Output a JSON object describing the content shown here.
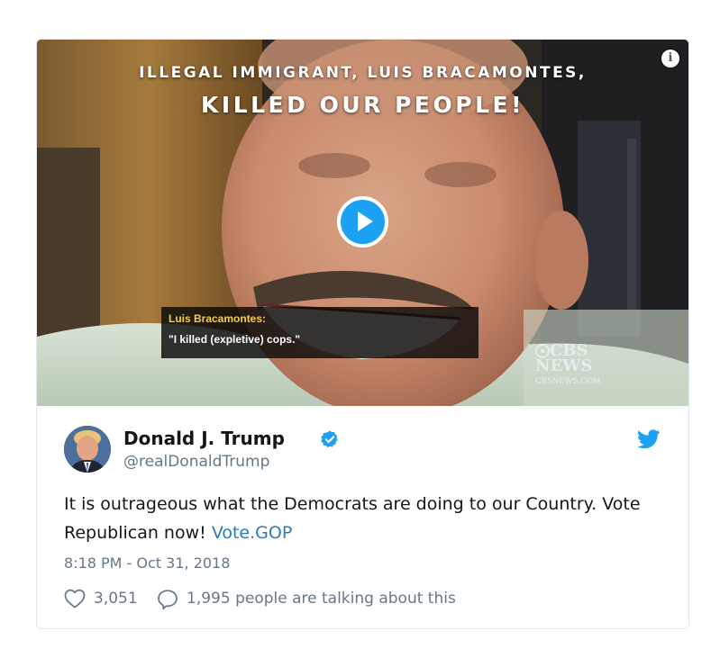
{
  "media": {
    "headline_line1": "ILLEGAL IMMIGRANT, LUIS BRACAMONTES,",
    "headline_line2": "KILLED OUR PEOPLE!",
    "caption_speaker": "Luis Bracamontes:",
    "caption_quote": "\"I killed (expletive) cops.\"",
    "network_logo_line1": "CBS",
    "network_logo_line2": "NEWS",
    "network_site": "CBSNEWS.COM",
    "info_icon": "info-icon",
    "play_icon": "play-icon"
  },
  "tweet": {
    "display_name": "Donald J. Trump",
    "handle": "@realDonaldTrump",
    "verified": true,
    "text_main": "It is outrageous what the Democrats are doing to our Country. Vote Republican now!",
    "text_link": "Vote.GOP",
    "timestamp": "8:18 PM - Oct 31, 2018",
    "likes": "3,051",
    "replies_text": "1,995 people are talking about this"
  },
  "colors": {
    "accent": "#1da1f2",
    "link": "#2b7bb9",
    "muted_text": "#657786",
    "primary_text": "#14171a",
    "border": "#e1e8ed",
    "caption_name": "#f5d142"
  }
}
